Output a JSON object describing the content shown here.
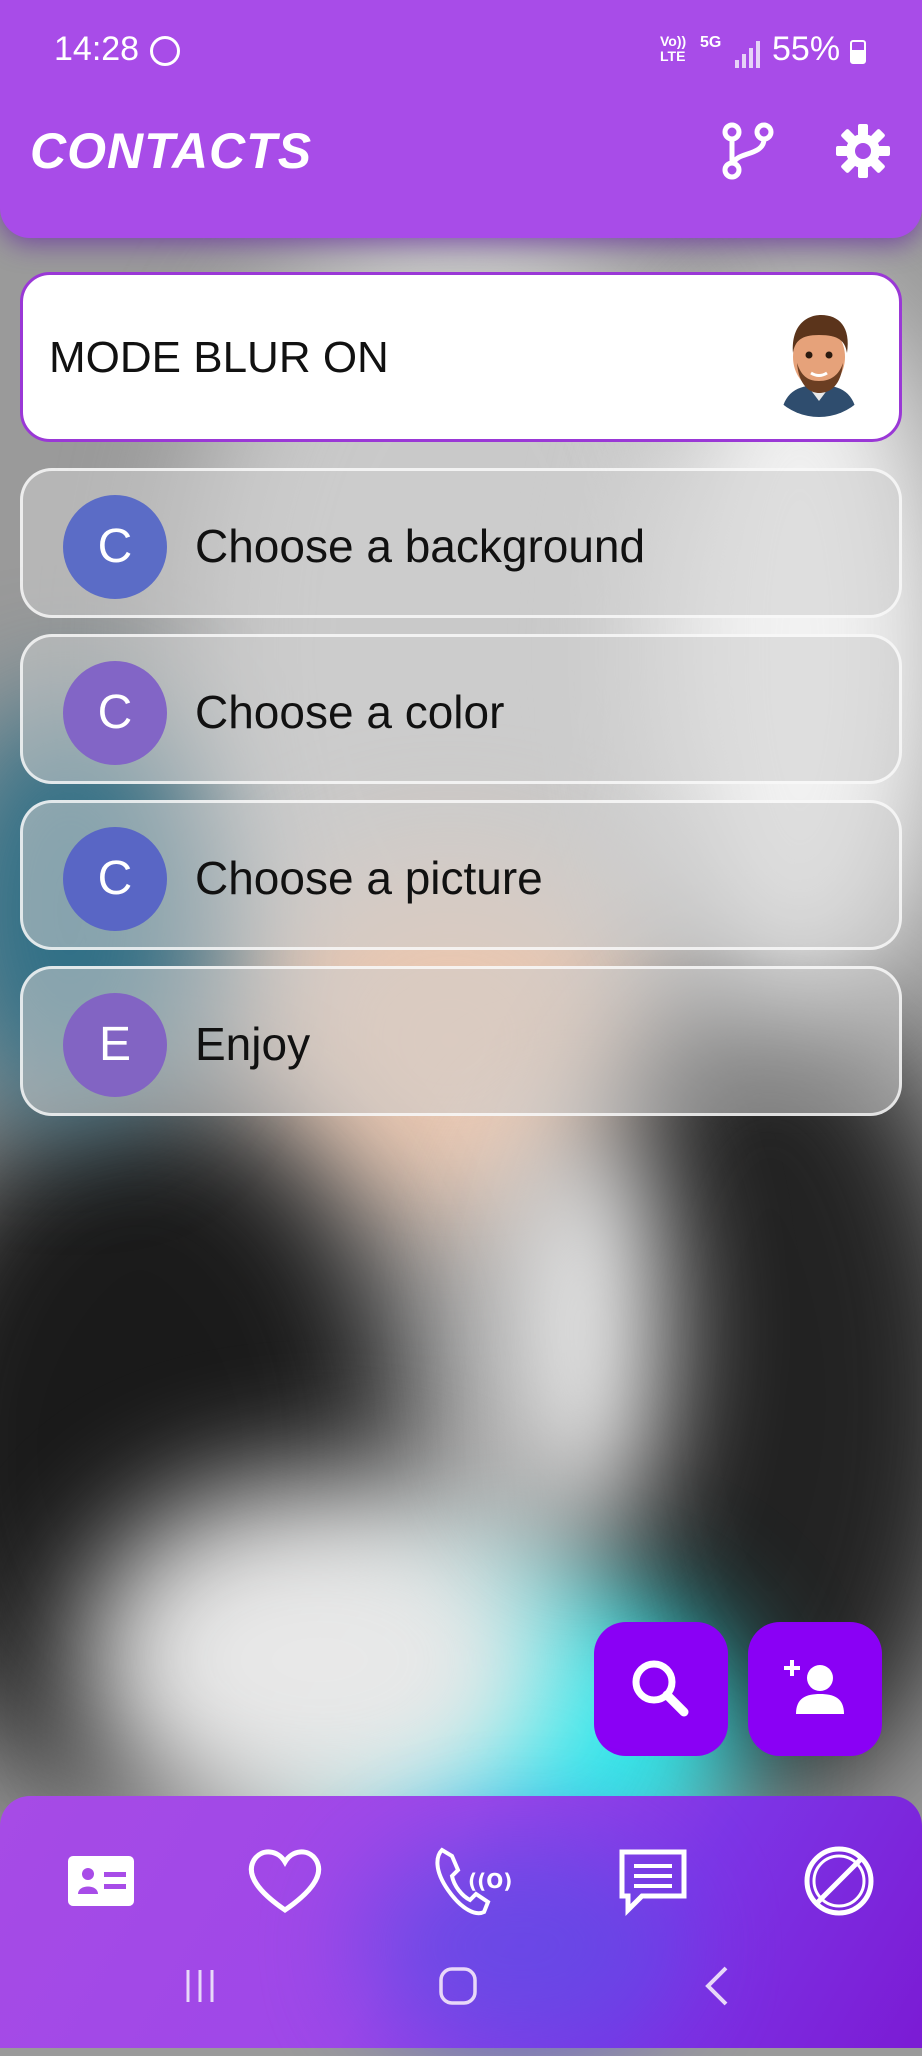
{
  "status_bar": {
    "time": "14:28",
    "network_top": "Vo))",
    "network_bottom": "LTE",
    "network_type": "5G",
    "battery": "55%"
  },
  "header": {
    "title": "CONTACTS",
    "branch_icon": "branch-icon",
    "settings_icon": "gear-icon"
  },
  "mode_card": {
    "text": "MODE BLUR ON"
  },
  "contacts": [
    {
      "initial": "C",
      "name": "Choose a background",
      "color": "#5b6cc6"
    },
    {
      "initial": "C",
      "name": "Choose a color",
      "color": "#8265c6"
    },
    {
      "initial": "C",
      "name": "Choose a picture",
      "color": "#5966c5"
    },
    {
      "initial": "E",
      "name": "Enjoy",
      "color": "#8264c3"
    }
  ],
  "fabs": {
    "search_icon": "search-icon",
    "add_contact_icon": "add-person-icon",
    "color": "#8a00f5"
  },
  "bottom_nav": {
    "items": [
      "contacts-card-icon",
      "heart-icon",
      "call-log-icon",
      "message-icon",
      "blocked-icon"
    ]
  },
  "system_nav": [
    "recents-icon",
    "home-icon",
    "back-icon"
  ],
  "colors": {
    "header": "#a84ce8",
    "accent": "#9a38d6"
  }
}
